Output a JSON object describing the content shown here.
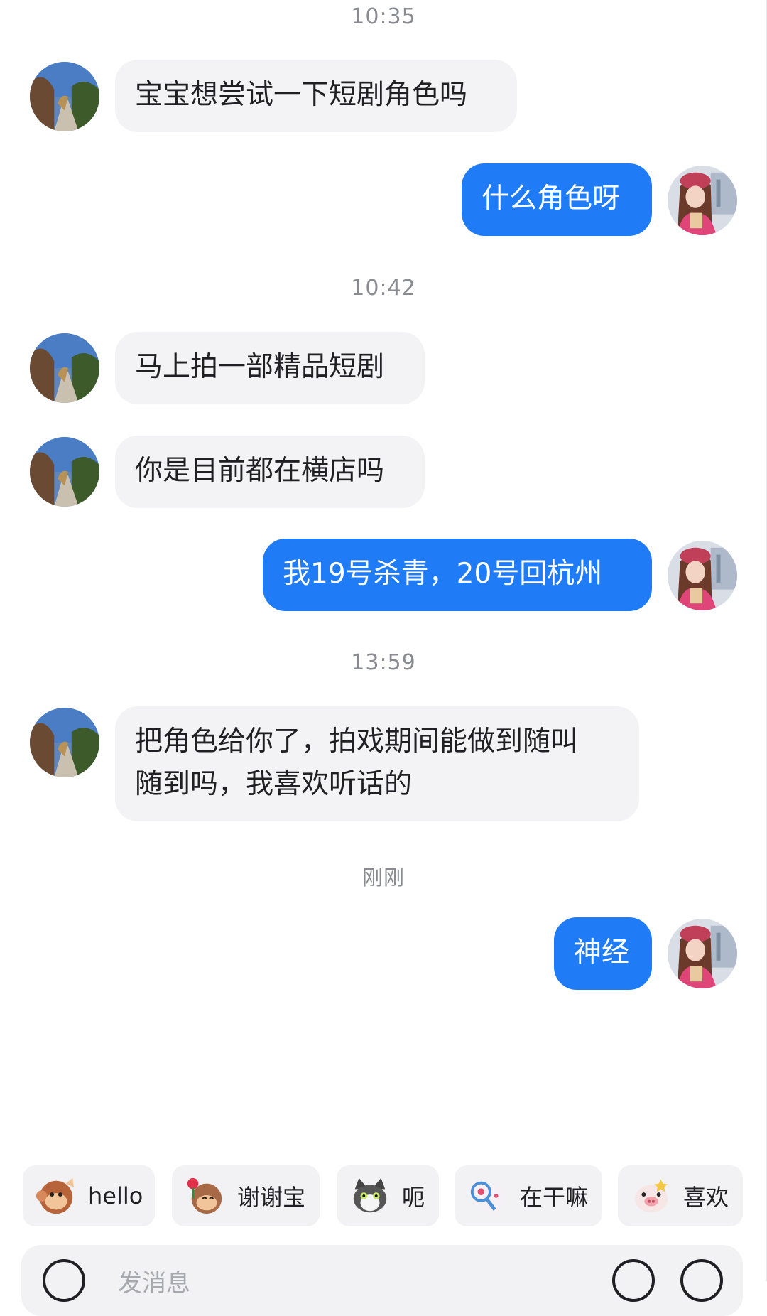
{
  "messages": [
    {
      "type": "timestamp",
      "text": "10:35"
    },
    {
      "type": "incoming",
      "text": "宝宝想尝试一下短剧角色吗"
    },
    {
      "type": "outgoing",
      "text": "什么角色呀"
    },
    {
      "type": "timestamp",
      "text": "10:42"
    },
    {
      "type": "incoming",
      "text": "马上拍一部精品短剧"
    },
    {
      "type": "incoming",
      "text": "你是目前都在横店吗"
    },
    {
      "type": "outgoing",
      "text": "我19号杀青，20号回杭州"
    },
    {
      "type": "timestamp",
      "text": "13:59"
    },
    {
      "type": "incoming",
      "line1": "把角色给你了，拍戏期间能做到随叫",
      "line2": "随到吗，我喜欢听话的"
    },
    {
      "type": "timestamp",
      "text": "刚刚"
    },
    {
      "type": "outgoing",
      "text": "神经"
    }
  ],
  "quick_replies": [
    {
      "label": "hello",
      "icon": "monkey-sticker-icon"
    },
    {
      "label": "谢谢宝",
      "icon": "monkey-rose-sticker-icon"
    },
    {
      "label": "呃",
      "icon": "cat-sticker-icon"
    },
    {
      "label": "在干嘛",
      "icon": "magnifier-sticker-icon"
    },
    {
      "label": "喜欢",
      "icon": "pig-sticker-icon"
    }
  ],
  "input": {
    "placeholder": "发消息"
  },
  "colors": {
    "outgoing_bubble": "#1f7cf6",
    "incoming_bubble": "#f3f3f5",
    "timestamp": "#8a8b91"
  }
}
